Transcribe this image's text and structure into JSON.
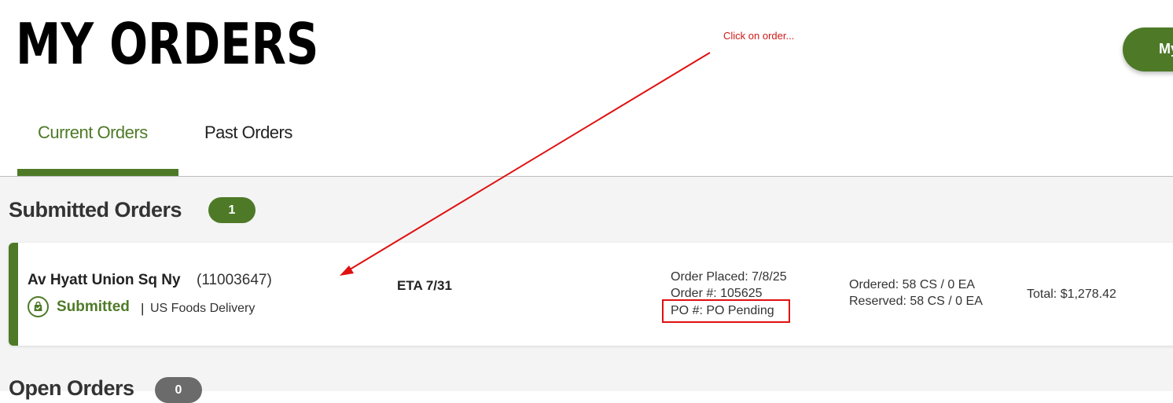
{
  "header": {
    "title": "MY ORDERS",
    "action_button": "My"
  },
  "tabs": [
    {
      "label": "Current Orders",
      "active": true
    },
    {
      "label": "Past Orders",
      "active": false
    }
  ],
  "sections": {
    "submitted": {
      "title": "Submitted Orders",
      "count": "1"
    },
    "open": {
      "title": "Open Orders",
      "count": "0"
    }
  },
  "order": {
    "customer_name": "Av Hyatt Union Sq Ny",
    "customer_number": "(11003647)",
    "status": "Submitted",
    "separator": "|",
    "delivery": "US Foods Delivery",
    "eta": "ETA 7/31",
    "order_placed": "Order Placed: 7/8/25",
    "order_number": "Order #: 105625",
    "po_number": "PO #: PO Pending",
    "ordered": "Ordered: 58 CS / 0 EA",
    "reserved": "Reserved: 58 CS / 0 EA",
    "total": "Total: $1,278.42"
  },
  "annotation": {
    "text": "Click on order..."
  },
  "colors": {
    "brand_green": "#4e7a28",
    "annotation_red": "#e01010",
    "badge_gray": "#6b6b6b"
  },
  "icons": {
    "status": "shopping-bag-check-icon"
  }
}
